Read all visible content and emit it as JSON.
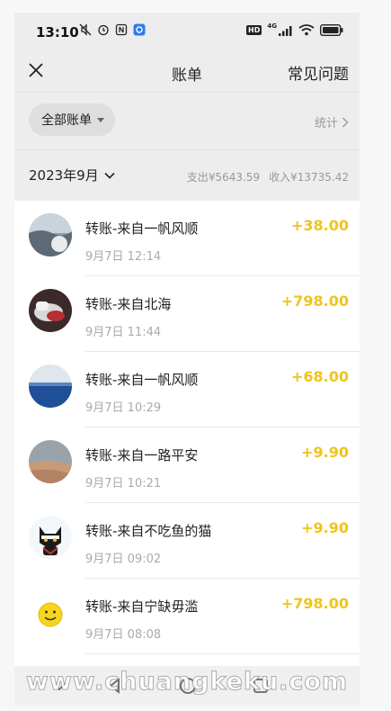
{
  "status_bar": {
    "time": "13:10",
    "network": "4G",
    "hd": "HD"
  },
  "nav": {
    "title": "账单",
    "faq": "常见问题"
  },
  "filter": {
    "chip_label": "全部账单",
    "stats_label": "统计"
  },
  "month": {
    "label": "2023年9月",
    "expense": "支出¥5643.59",
    "income": "收入¥13735.42"
  },
  "transactions": [
    {
      "title": "转账-来自一帆风顺",
      "time": "9月7日 12:14",
      "amount": "+38.00"
    },
    {
      "title": "转账-来自北海",
      "time": "9月7日 11:44",
      "amount": "+798.00"
    },
    {
      "title": "转账-来自一帆风顺",
      "time": "9月7日 10:29",
      "amount": "+68.00"
    },
    {
      "title": "转账-来自一路平安",
      "time": "9月7日 10:21",
      "amount": "+9.90"
    },
    {
      "title": "转账-来自不吃鱼的猫",
      "time": "9月7日 09:02",
      "amount": "+9.90"
    },
    {
      "title": "转账-来自宁缺毋滥",
      "time": "9月7日 08:08",
      "amount": "+798.00"
    }
  ],
  "watermark": "www.chuangkeku.com",
  "colors": {
    "amount": "#f0c419",
    "background": "#ededed"
  },
  "icons": {
    "close": "close-icon",
    "stats_chevron": "chevron-right-icon",
    "month_chevron": "chevron-down-icon",
    "back": "back-icon",
    "home": "home-icon",
    "recent": "recent-apps-icon"
  }
}
